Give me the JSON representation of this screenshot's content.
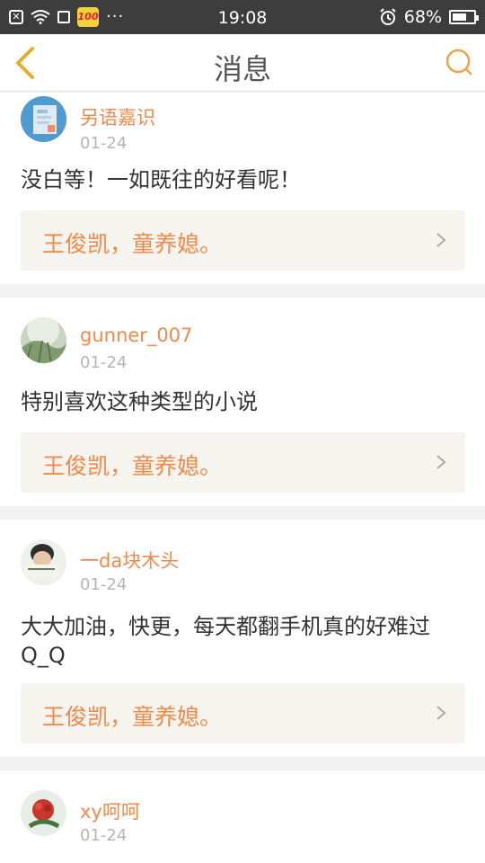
{
  "status_bar": {
    "time": "19:08",
    "battery": "68%",
    "battery_level": 0.68,
    "app_badge": "100",
    "more": "···",
    "icons": [
      "close-box-icon",
      "wifi-icon",
      "sim-icon",
      "app-icon",
      "alarm-icon",
      "battery-icon"
    ]
  },
  "header": {
    "title": "消息",
    "back_icon": "chevron-left-icon",
    "search_icon": "search-icon",
    "accent_color": "#f0a24b"
  },
  "messages": [
    {
      "username": "另语嘉识",
      "date": "01-24",
      "comment": "没白等！一如既往的好看呢！",
      "quote": "王俊凯，童养媳。"
    },
    {
      "username": "gunner_007",
      "date": "01-24",
      "comment": "特别喜欢这种类型的小说",
      "quote": "王俊凯，童养媳。"
    },
    {
      "username": "一da块木头",
      "date": "01-24",
      "comment": "大大加油，快更，每天都翻手机真的好难过Q_Q",
      "quote": "王俊凯，童养媳。"
    },
    {
      "username": "xy呵呵",
      "date": "01-24",
      "comment": "",
      "quote": ""
    }
  ],
  "colors": {
    "username": "#f08a4b",
    "date": "#b5b5b5",
    "quote_bg": "#f5f4ee",
    "divider_bg": "#f2f2f2"
  }
}
